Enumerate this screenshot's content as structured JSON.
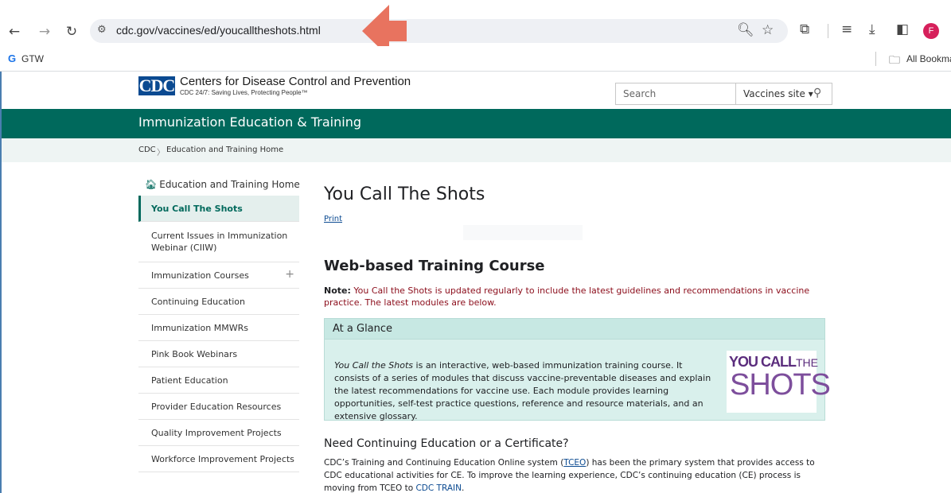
{
  "browser": {
    "url": "cdc.gov/vaccines/ed/youcalltheshots.html",
    "profile_initial": "F",
    "bookmarks": {
      "g_label": "G",
      "gtw_label": "GTW",
      "all_label": "All Bookma"
    }
  },
  "header": {
    "logo_text": "CDC",
    "org_name": "Centers for Disease Control and Prevention",
    "tagline": "CDC 24/7: Saving Lives, Protecting People™",
    "search_placeholder": "Search",
    "search_scope": "Vaccines site ▾"
  },
  "banner": {
    "title": "Immunization Education & Training"
  },
  "breadcrumb": [
    "CDC",
    "Education and Training Home"
  ],
  "sidebar": {
    "home_label": "Education and Training Home",
    "items": [
      {
        "label": "You Call The Shots",
        "active": true
      },
      {
        "label": "Current Issues in Immunization Webinar (CIIW)"
      },
      {
        "label": "Immunization Courses",
        "expandable": true
      },
      {
        "label": "Continuing Education"
      },
      {
        "label": "Immunization MMWRs"
      },
      {
        "label": "Pink Book Webinars"
      },
      {
        "label": "Patient Education"
      },
      {
        "label": "Provider Education Resources"
      },
      {
        "label": "Quality Improvement Projects"
      },
      {
        "label": "Workforce Improvement Projects"
      }
    ]
  },
  "main": {
    "title": "You Call The Shots",
    "print_label": "Print",
    "section_title": "Web-based Training Course",
    "note_label": "Note:",
    "note_text": "You Call the Shots is updated regularly to include the latest guidelines and recommendations in vaccine practice. The latest modules are below.",
    "glance": {
      "title": "At a Glance",
      "course_name": "You Call the Shots",
      "text": "is an interactive, web-based immunization training course. It consists of a series of modules that discuss vaccine-preventable diseases and explain the latest recommendations for vaccine use. Each module provides learning opportunities, self-test practice questions, reference and resource materials, and an extensive glossary.",
      "logo_line1": "YOU CALL",
      "logo_the": "THE",
      "logo_line2": "SHOTS"
    },
    "ce_heading": "Need Continuing Education or a Certificate?",
    "ce_text_1": "CDC’s Training and Continuing Education Online system (",
    "ce_link_1": "TCEO",
    "ce_text_2": ") has been the primary system that provides access to CDC educational activities for CE. To improve the learning experience, CDC’s continuing education (CE) process is moving from TCEO to ",
    "ce_link_2": "CDC TRAIN",
    "ce_text_3": "."
  },
  "colors": {
    "banner": "#00695c",
    "note": "#8b0c1a",
    "glance_bg": "#d9f0ec",
    "link": "#0b4a91",
    "attention_arrow": "#e8735f"
  }
}
